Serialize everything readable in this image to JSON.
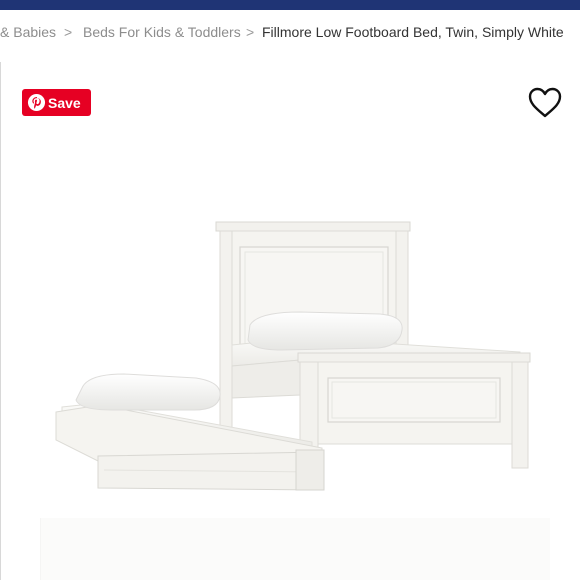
{
  "breadcrumb": {
    "items": [
      {
        "label": "& Babies"
      },
      {
        "label": "Beds For Kids & Toddlers"
      },
      {
        "label": "Fillmore Low Footboard Bed, Twin, Simply White"
      }
    ],
    "separator": ">"
  },
  "actions": {
    "save_label": "Save",
    "pin_icon": "pinterest-icon",
    "favorite_icon": "heart-outline-icon"
  },
  "colors": {
    "top_bar": "#1f3475",
    "save_button": "#e60023",
    "bed": "#f4f3ef"
  }
}
